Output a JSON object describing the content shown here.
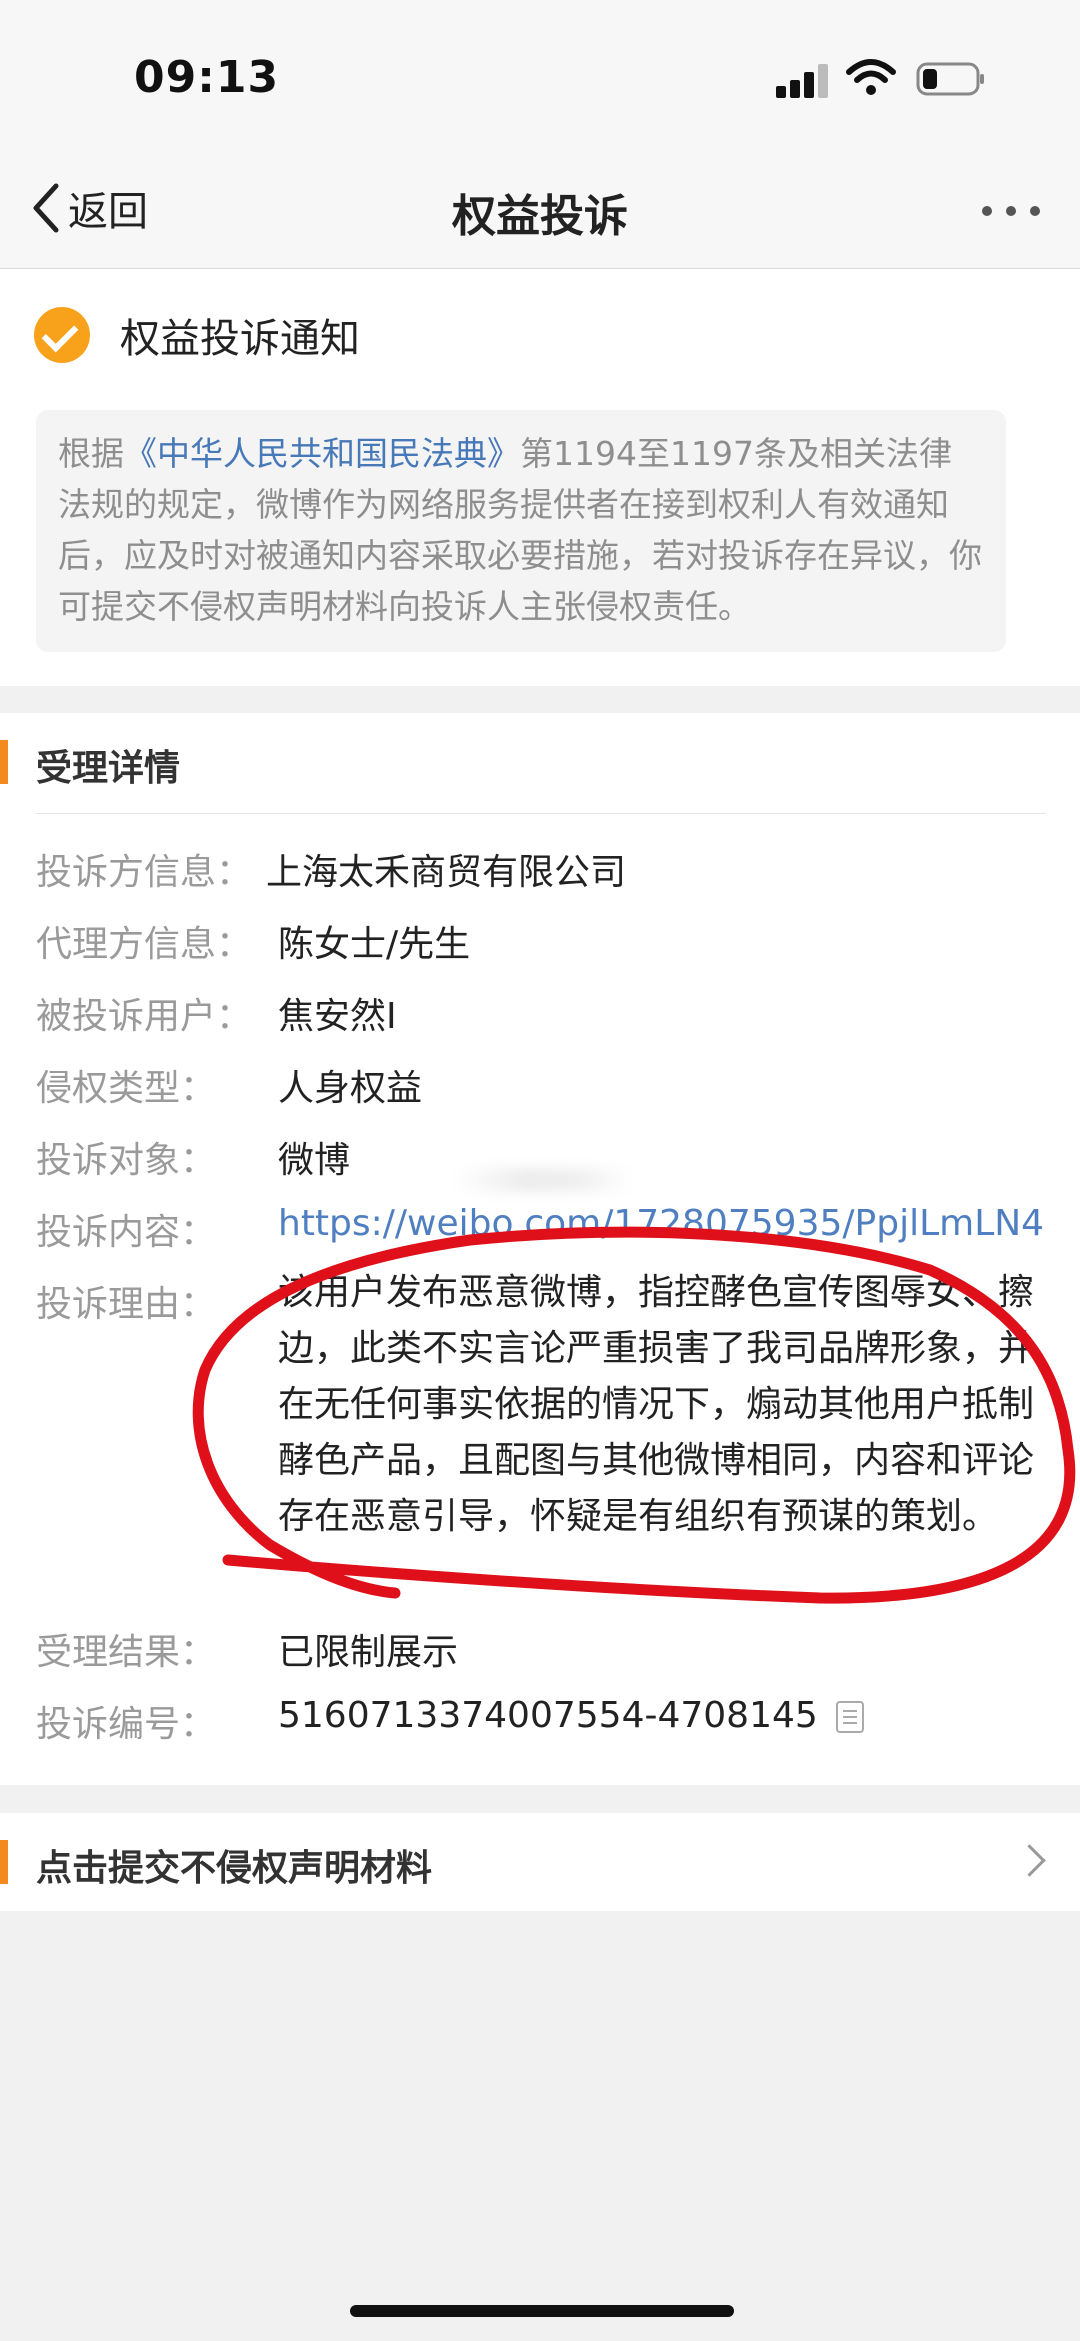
{
  "status_bar": {
    "time": "09:13"
  },
  "nav": {
    "back_label": "返回",
    "title": "权益投诉"
  },
  "notice": {
    "title": "权益投诉通知",
    "text_prefix": "根据",
    "law_name": "《中华人民共和国民法典》",
    "text_suffix": "第1194至1197条及相关法律法规的规定，微博作为网络服务提供者在接到权利人有效通知后，应及时对被通知内容采取必要措施，若对投诉存在异议，你可提交不侵权声明材料向投诉人主张侵权责任。"
  },
  "details": {
    "section_title": "受理详情",
    "rows": [
      {
        "label": "投诉方信息：",
        "value": "上海太禾商贸有限公司"
      },
      {
        "label": "代理方信息：",
        "value": "陈女士/先生"
      },
      {
        "label": "被投诉用户：",
        "value": "焦安然I"
      },
      {
        "label": "侵权类型：",
        "value": "人身权益"
      },
      {
        "label": "投诉对象：",
        "value": "微博"
      },
      {
        "label": "投诉内容：",
        "value": "https://weibo.com/1728075935/PpjlLmLN4"
      },
      {
        "label": "投诉理由：",
        "value": "该用户发布恶意微博，指控酵色宣传图辱女、擦边，此类不实言论严重损害了我司品牌形象，并在无任何事实依据的情况下，煽动其他用户抵制酵色产品，且配图与其他微博相同，内容和评论存在恶意引导，怀疑是有组织有预谋的策划。"
      },
      {
        "label": "受理结果：",
        "value": "已限制展示"
      },
      {
        "label": "投诉编号：",
        "value": "5160713374007554-4708145"
      }
    ]
  },
  "action": {
    "label": "点击提交不侵权声明材料"
  },
  "colors": {
    "accent": "#f28a20",
    "check": "#f8a21b",
    "link": "#4f7fc0",
    "annotation": "#e0101a"
  },
  "icons": [
    "back-chevron-icon",
    "more-icon",
    "check-circle-icon",
    "copy-icon",
    "chevron-right-icon",
    "signal-icon",
    "wifi-icon",
    "battery-icon"
  ]
}
